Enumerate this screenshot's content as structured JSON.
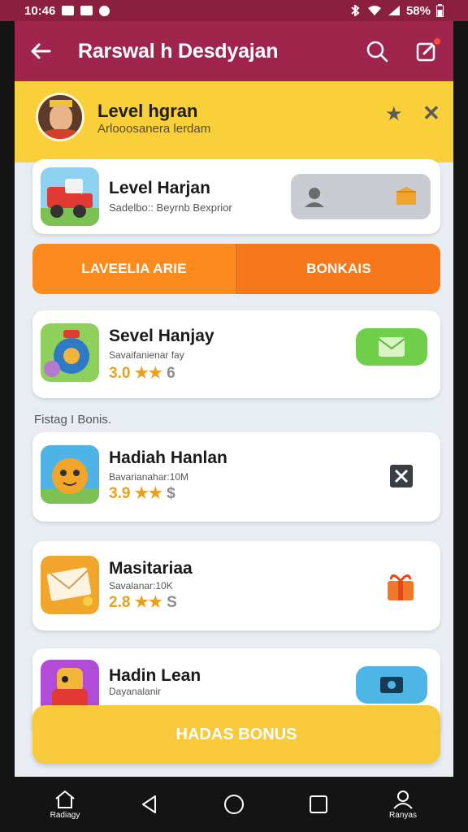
{
  "status_bar": {
    "time": "10:46",
    "battery": "58%"
  },
  "app_bar": {
    "title": "Rarswal h Desdyajan"
  },
  "banner": {
    "title": "Level hgran",
    "subtitle": "Arlooosanera lerdam"
  },
  "featured": {
    "title": "Level Harjan",
    "subtitle": "Sadelbo:: Beyrnb Bexprior"
  },
  "tabs": [
    {
      "label": "LAVEELIA ARIE"
    },
    {
      "label": "BONKAIS"
    }
  ],
  "items_top": [
    {
      "title": "Sevel Hanjay",
      "subtitle": "Savaifanienar fay",
      "rating": "3.0",
      "stars": "★★",
      "level": "6"
    }
  ],
  "section_label": "Fistag I Bonis.",
  "items": [
    {
      "title": "Hadiah Hanlan",
      "subtitle": "Bavarianahar:10M",
      "rating": "3.9",
      "stars": "★★",
      "level": "$"
    },
    {
      "title": "Masitariaa",
      "subtitle": "Savalanar:10K",
      "rating": "2.8",
      "stars": "★★",
      "level": "S"
    },
    {
      "title": "Hadin Lean",
      "subtitle": "Dayanalanir",
      "rating": "",
      "stars": "",
      "level": ""
    }
  ],
  "cta": {
    "label": "HADAS BONUS"
  },
  "nav": [
    {
      "label": "Radiagy",
      "icon": "home-icon"
    },
    {
      "label": "",
      "icon": "back-icon"
    },
    {
      "label": "",
      "icon": "home-circle-icon"
    },
    {
      "label": "",
      "icon": "recents-icon"
    },
    {
      "label": "Ranyas",
      "icon": "profile-icon"
    }
  ],
  "colors": {
    "appbar": "#a0254c",
    "banner": "#f9cf3a",
    "tab_orange": "#fb8b1e",
    "cta": "#f8c93a",
    "green": "#6fcf4a",
    "blue": "#4db6e6"
  }
}
